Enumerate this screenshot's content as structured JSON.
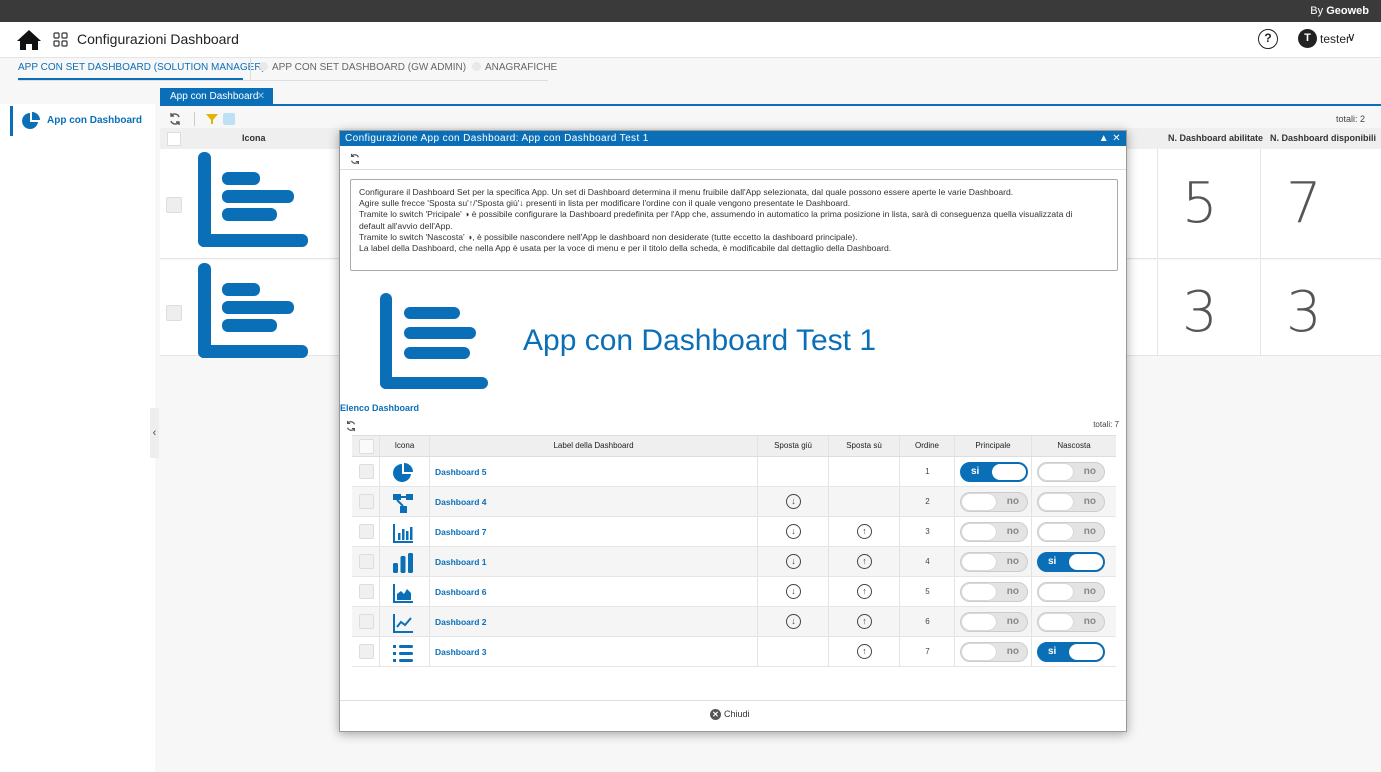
{
  "brand": {
    "prefix": "By",
    "name": "Geoweb"
  },
  "header": {
    "title": "Configurazioni Dashboard",
    "help": "?",
    "user_initial": "T",
    "user_name": "tester",
    "user_chevron": "∨"
  },
  "top_tabs": [
    {
      "label": "APP CON SET DASHBOARD (SOLUTION MANAGER)"
    },
    {
      "label": "APP CON SET DASHBOARD (GW ADMIN)"
    },
    {
      "label": "ANAGRAFICHE"
    }
  ],
  "sidebar": {
    "item_label": "App con Dashboard",
    "collapse": "‹"
  },
  "subtab": {
    "label": "App con Dashboard",
    "close": "✕"
  },
  "grid": {
    "totals": "totali: 2",
    "headers": {
      "icona": "Icona",
      "abilitate": "N. Dashboard abilitate",
      "disponibili": "N. Dashboard disponibili"
    },
    "rows": [
      {
        "abilitate": "5",
        "disponibili": "7"
      },
      {
        "abilitate": "3",
        "disponibili": "3"
      }
    ]
  },
  "modal": {
    "title": "Configurazione App con Dashboard: App con Dashboard Test 1",
    "controls": "▲ ✕",
    "info": [
      "Configurare il Dashboard Set per la specifica App. Un set di Dashboard determina il menu fruibile dall'App selezionata, dal quale possono essere aperte le varie Dashboard.",
      "Agire sulle frecce 'Sposta su'↑/'Sposta giù'↓ presenti in lista per modificare l'ordine con il quale vengono presentate le Dashboard.",
      "Tramite lo switch 'Pricipale' ◑ è possibile configurare la Dashboard predefinita per l'App che, assumendo in automatico la prima posizione in lista, sarà di conseguenza quella visualizzata di",
      "default all'avvio dell'App.",
      "Tramite lo switch 'Nascosta' ◑, è possibile nascondere nell'App le dashboard non desiderate (tutte eccetto la dashboard principale).",
      "La label della Dashboard, che nella App è usata per la voce di menu e per il titolo della scheda, è modificabile dal dettaglio della Dashboard."
    ],
    "app_name": "App con Dashboard Test 1",
    "list_title": "Elenco Dashboard",
    "list_totals": "totali: 7",
    "columns": {
      "icona": "Icona",
      "label": "Label della Dashboard",
      "down": "Sposta giù",
      "up": "Sposta sù",
      "ordine": "Ordine",
      "principale": "Principale",
      "nascosta": "Nascosta"
    },
    "rows": [
      {
        "icon": "pie-chart-icon",
        "label": "Dashboard 5",
        "down": false,
        "up": false,
        "ordine": "1",
        "principale": "si",
        "nascosta": "no"
      },
      {
        "icon": "flow-diagram-icon",
        "label": "Dashboard 4",
        "down": true,
        "up": false,
        "ordine": "2",
        "principale": "no",
        "nascosta": "no"
      },
      {
        "icon": "bar-chart-axis-icon",
        "label": "Dashboard 7",
        "down": true,
        "up": true,
        "ordine": "3",
        "principale": "no",
        "nascosta": "no"
      },
      {
        "icon": "bar-chart-icon",
        "label": "Dashboard 1",
        "down": true,
        "up": true,
        "ordine": "4",
        "principale": "no",
        "nascosta": "si"
      },
      {
        "icon": "area-chart-icon",
        "label": "Dashboard 6",
        "down": true,
        "up": true,
        "ordine": "5",
        "principale": "no",
        "nascosta": "no"
      },
      {
        "icon": "line-chart-icon",
        "label": "Dashboard 2",
        "down": true,
        "up": true,
        "ordine": "6",
        "principale": "no",
        "nascosta": "no"
      },
      {
        "icon": "list-icon",
        "label": "Dashboard 3",
        "down": false,
        "up": true,
        "ordine": "7",
        "principale": "no",
        "nascosta": "si"
      }
    ],
    "close_label": "Chiudi"
  },
  "colors": {
    "accent": "#0b6fb8",
    "topbar": "#3a3a3a"
  }
}
